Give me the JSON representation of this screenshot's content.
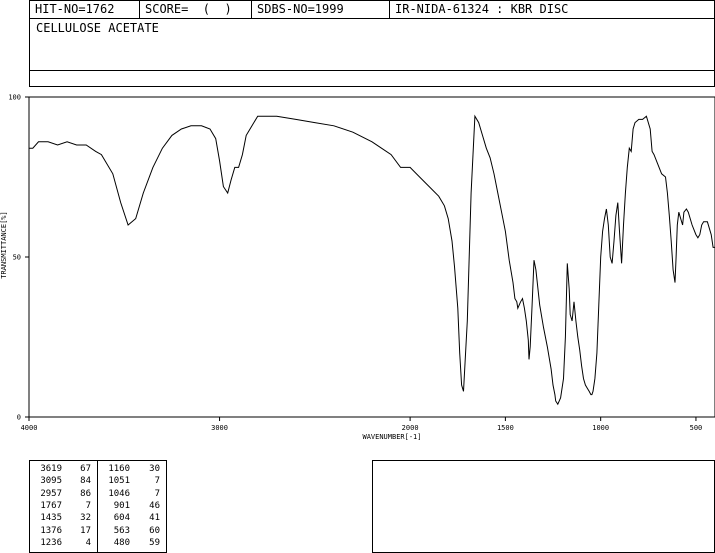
{
  "header": {
    "hit_no": "HIT-NO=1762",
    "score": "SCORE=  (  )",
    "sdbs_no": "SDBS-NO=1999",
    "ir_info": "IR-NIDA-61324 : KBR DISC",
    "compound": "CELLULOSE ACETATE"
  },
  "chart_data": {
    "type": "line",
    "xlabel": "WAVENUMBER[-1]",
    "ylabel": "TRANSMITTANCE[%]",
    "xlim": [
      4000,
      400
    ],
    "ylim": [
      0,
      100
    ],
    "x_ticks": [
      4000,
      3000,
      2000,
      1500,
      1000,
      500
    ],
    "x_tick_labels": [
      "4000",
      "3000",
      "2000",
      "1500",
      "1000",
      "500"
    ],
    "y_ticks": [
      0,
      50,
      100
    ],
    "y_tick_labels": [
      "0",
      "50",
      "100"
    ],
    "grid": false,
    "x": [
      4000,
      3980,
      3950,
      3900,
      3850,
      3800,
      3750,
      3700,
      3650,
      3620,
      3560,
      3519,
      3480,
      3440,
      3400,
      3350,
      3300,
      3250,
      3200,
      3150,
      3095,
      3050,
      3020,
      3000,
      2980,
      2957,
      2940,
      2920,
      2900,
      2880,
      2860,
      2800,
      2700,
      2600,
      2500,
      2400,
      2300,
      2200,
      2150,
      2100,
      2050,
      2000,
      1950,
      1900,
      1850,
      1820,
      1800,
      1780,
      1767,
      1750,
      1740,
      1730,
      1720,
      1700,
      1680,
      1660,
      1640,
      1620,
      1600,
      1580,
      1560,
      1540,
      1520,
      1500,
      1480,
      1460,
      1450,
      1440,
      1435,
      1420,
      1410,
      1400,
      1390,
      1380,
      1376,
      1370,
      1360,
      1350,
      1340,
      1320,
      1300,
      1280,
      1260,
      1250,
      1240,
      1236,
      1225,
      1210,
      1195,
      1185,
      1175,
      1165,
      1160,
      1150,
      1140,
      1130,
      1120,
      1110,
      1100,
      1090,
      1080,
      1070,
      1060,
      1051,
      1046,
      1040,
      1030,
      1020,
      1010,
      1000,
      990,
      980,
      970,
      960,
      950,
      940,
      930,
      920,
      910,
      901,
      890,
      880,
      870,
      860,
      850,
      840,
      830,
      820,
      800,
      780,
      760,
      740,
      730,
      720,
      700,
      680,
      660,
      650,
      640,
      630,
      620,
      610,
      604,
      598,
      590,
      580,
      570,
      563,
      550,
      540,
      520,
      500,
      490,
      480,
      470,
      460,
      440,
      420,
      410,
      400
    ],
    "values": [
      84,
      84,
      86,
      86,
      85,
      86,
      85,
      85,
      83,
      82,
      76,
      67,
      60,
      62,
      70,
      78,
      84,
      88,
      90,
      91,
      91,
      90,
      87,
      80,
      72,
      70,
      74,
      78,
      78,
      82,
      88,
      94,
      94,
      93,
      92,
      91,
      89,
      86,
      84,
      82,
      78,
      78,
      75,
      72,
      69,
      66,
      62,
      55,
      47,
      34,
      20,
      10,
      8,
      30,
      70,
      94,
      92,
      88,
      84,
      81,
      76,
      70,
      64,
      58,
      49,
      42,
      37,
      36,
      34,
      36,
      37,
      34,
      30,
      24,
      18,
      22,
      35,
      49,
      46,
      35,
      28,
      22,
      15,
      10,
      7,
      5,
      4,
      6,
      12,
      25,
      48,
      40,
      32,
      30,
      36,
      30,
      25,
      21,
      16,
      12,
      10,
      9,
      8,
      7,
      7,
      8,
      12,
      20,
      35,
      50,
      58,
      62,
      65,
      60,
      50,
      48,
      55,
      63,
      67,
      58,
      48,
      60,
      70,
      78,
      84,
      83,
      90,
      92,
      93,
      93,
      94,
      90,
      83,
      82,
      79,
      76,
      75,
      70,
      63,
      55,
      46,
      42,
      50,
      60,
      64,
      62,
      60,
      64,
      65,
      64,
      60,
      57,
      56,
      57,
      60,
      61,
      61,
      57,
      53,
      53
    ]
  },
  "peaks": {
    "col1": [
      {
        "wn": "3619",
        "t": "67"
      },
      {
        "wn": "3095",
        "t": "84"
      },
      {
        "wn": "2957",
        "t": "86"
      },
      {
        "wn": "1767",
        "t": "7"
      },
      {
        "wn": "1435",
        "t": "32"
      },
      {
        "wn": "1376",
        "t": "17"
      },
      {
        "wn": "1236",
        "t": "4"
      }
    ],
    "col2": [
      {
        "wn": "1160",
        "t": "30"
      },
      {
        "wn": "1051",
        "t": "7"
      },
      {
        "wn": "1046",
        "t": "7"
      },
      {
        "wn": "901",
        "t": "46"
      },
      {
        "wn": "604",
        "t": "41"
      },
      {
        "wn": "563",
        "t": "60"
      },
      {
        "wn": "480",
        "t": "59"
      }
    ]
  }
}
